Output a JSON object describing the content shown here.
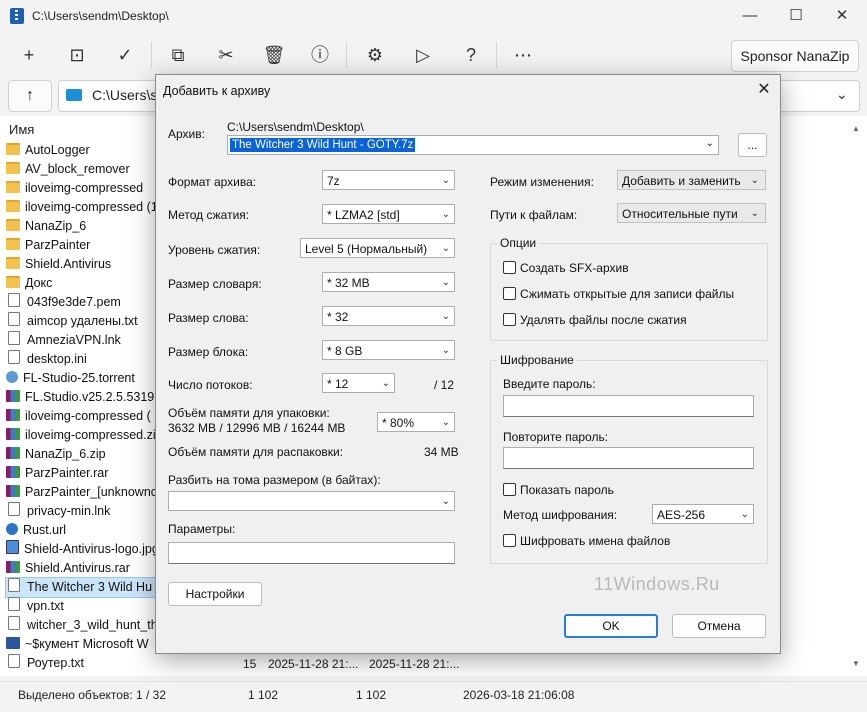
{
  "window": {
    "title": "C:\\Users\\sendm\\Desktop\\",
    "minimize_glyph": "—",
    "maximize_glyph": "☐",
    "close_glyph": "✕"
  },
  "toolbar": {
    "buttons": [
      {
        "name": "add-icon",
        "glyph": "+"
      },
      {
        "name": "extract-icon",
        "glyph": "⊡"
      },
      {
        "name": "test-icon",
        "glyph": "✓"
      },
      {
        "name": "copy-icon",
        "glyph": "⧉"
      },
      {
        "name": "move-icon",
        "glyph": "✂"
      },
      {
        "name": "delete-icon",
        "glyph": "🗑"
      },
      {
        "name": "info-icon",
        "glyph": "ⓘ"
      },
      {
        "name": "settings-icon",
        "glyph": "⚙"
      },
      {
        "name": "run-icon",
        "glyph": "▷"
      },
      {
        "name": "help-icon",
        "glyph": "?"
      },
      {
        "name": "more-icon",
        "glyph": "⋯"
      }
    ],
    "sponsor_label": "Sponsor NanaZip"
  },
  "address": {
    "up_glyph": "↑",
    "path": "C:\\Users\\s",
    "dropdown_glyph": "⌄"
  },
  "file_list": {
    "column_header": "Имя",
    "items": [
      {
        "name": "AutoLogger",
        "type": "folder"
      },
      {
        "name": "AV_block_remover",
        "type": "folder"
      },
      {
        "name": "iloveimg-compressed",
        "type": "folder"
      },
      {
        "name": "iloveimg-compressed (1)",
        "type": "folder"
      },
      {
        "name": "NanaZip_6",
        "type": "folder"
      },
      {
        "name": "ParzPainter",
        "type": "folder"
      },
      {
        "name": "Shield.Antivirus",
        "type": "folder"
      },
      {
        "name": "Докс",
        "type": "folder"
      },
      {
        "name": "043f9e3de7.pem",
        "type": "doc"
      },
      {
        "name": "aimcop удалены.txt",
        "type": "doc"
      },
      {
        "name": "AmneziaVPN.lnk",
        "type": "doc"
      },
      {
        "name": "desktop.ini",
        "type": "doc"
      },
      {
        "name": "FL-Studio-25.torrent",
        "type": "torrent"
      },
      {
        "name": "FL.Studio.v25.2.5.5319.K",
        "type": "rar"
      },
      {
        "name": "iloveimg-compressed (",
        "type": "rar"
      },
      {
        "name": "iloveimg-compressed.zip",
        "type": "rar"
      },
      {
        "name": "NanaZip_6.zip",
        "type": "rar"
      },
      {
        "name": "ParzPainter.rar",
        "type": "rar"
      },
      {
        "name": "ParzPainter_[unknownc",
        "type": "rar"
      },
      {
        "name": "privacy-min.lnk",
        "type": "doc"
      },
      {
        "name": "Rust.url",
        "type": "web"
      },
      {
        "name": "Shield-Antivirus-logo.jpg",
        "type": "img"
      },
      {
        "name": "Shield.Antivirus.rar",
        "type": "rar"
      },
      {
        "name": "The Witcher 3 Wild Hu",
        "type": "doc",
        "selected": true
      },
      {
        "name": "vpn.txt",
        "type": "doc"
      },
      {
        "name": "witcher_3_wild_hunt_th",
        "type": "doc"
      },
      {
        "name": "~$кумент Microsoft W",
        "type": "word"
      },
      {
        "name": "Роутер.txt",
        "type": "doc"
      }
    ],
    "last_row": {
      "size": "15",
      "modified": "2025-11-28 21:...",
      "created": "2025-11-28 21:..."
    }
  },
  "status": {
    "selected": "Выделено объектов: 1 / 32",
    "size1": "1 102",
    "size2": "1 102",
    "date": "2026-03-18 21:06:08"
  },
  "dialog": {
    "title": "Добавить к архиву",
    "close_glyph": "✕",
    "archive_label": "Архив:",
    "archive_path": "C:\\Users\\sendm\\Desktop\\",
    "archive_name": "The Witcher 3 Wild Hunt - GOTY.7z",
    "browse_label": "...",
    "format_label": "Формат архива:",
    "format_value": "7z",
    "method_label": "Метод сжатия:",
    "method_value": "*  LZMA2 [std]",
    "level_label": "Уровень сжатия:",
    "level_value": "Level 5 (Нормальный)",
    "dict_label": "Размер словаря:",
    "dict_value": "*  32 MB",
    "word_label": "Размер слова:",
    "word_value": "*  32",
    "block_label": "Размер блока:",
    "block_value": "*  8 GB",
    "threads_label": "Число потоков:",
    "threads_value": "*  12",
    "threads_max": "/ 12",
    "mem_pack_label": "Объём памяти для упаковки:",
    "mem_pack_value": "3632 MB / 12996 MB / 16244 MB",
    "mem_pack_percent": "*  80%",
    "mem_unpack_label": "Объём памяти для распаковки:",
    "mem_unpack_value": "34 MB",
    "split_label": "Разбить на тома размером (в байтах):",
    "split_value": "",
    "params_label": "Параметры:",
    "params_value": "",
    "settings_button": "Настройки",
    "update_mode_label": "Режим изменения:",
    "update_mode_value": "Добавить и заменить",
    "paths_label": "Пути к файлам:",
    "paths_value": "Относительные пути",
    "options_group": "Опции",
    "opt_sfx": "Создать SFX-архив",
    "opt_shared": "Сжимать открытые для записи файлы",
    "opt_delete": "Удалять файлы после сжатия",
    "encryption_group": "Шифрование",
    "password_label": "Введите пароль:",
    "password_repeat_label": "Повторите пароль:",
    "show_password": "Показать пароль",
    "enc_method_label": "Метод шифрования:",
    "enc_method_value": "AES-256",
    "encrypt_names": "Шифровать имена файлов",
    "ok_button": "OK",
    "cancel_button": "Отмена",
    "watermark": "11Windows.Ru",
    "dropdown_glyph": "⌄"
  }
}
